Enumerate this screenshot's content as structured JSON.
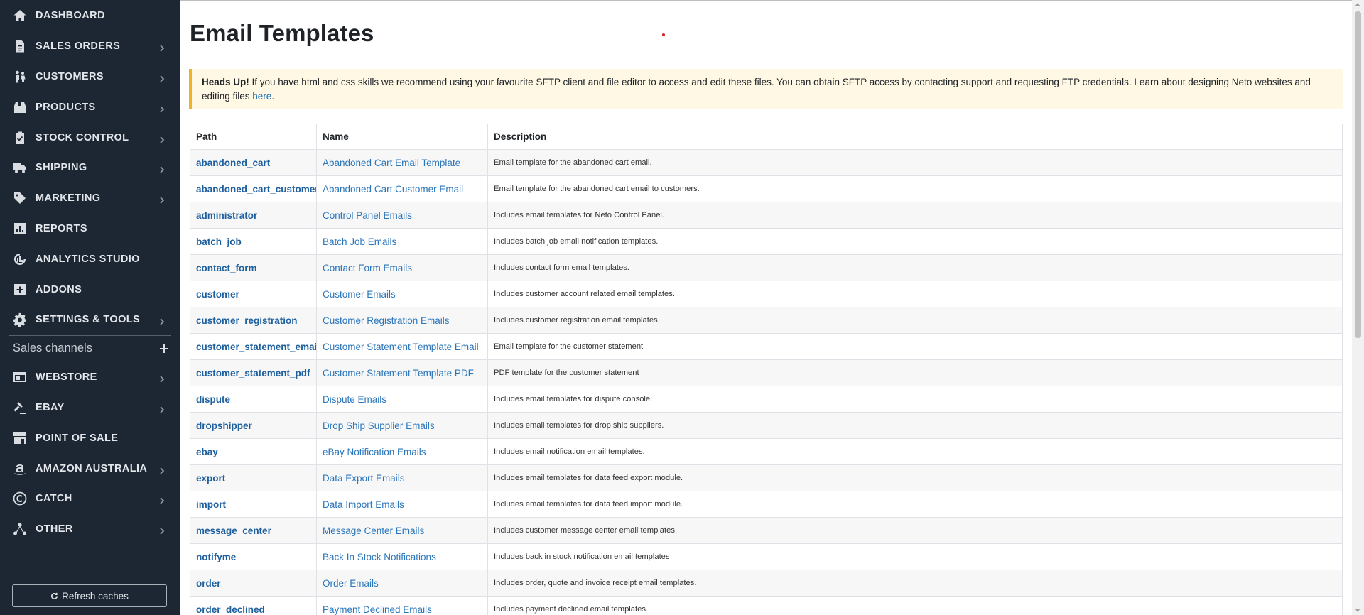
{
  "sidebar": {
    "items": [
      {
        "label": "DASHBOARD",
        "icon": "home-icon",
        "chevron": false
      },
      {
        "label": "SALES ORDERS",
        "icon": "file-icon",
        "chevron": true
      },
      {
        "label": "CUSTOMERS",
        "icon": "users-icon",
        "chevron": true
      },
      {
        "label": "PRODUCTS",
        "icon": "box-icon",
        "chevron": true
      },
      {
        "label": "STOCK CONTROL",
        "icon": "clipboard-check-icon",
        "chevron": true
      },
      {
        "label": "SHIPPING",
        "icon": "truck-icon",
        "chevron": true
      },
      {
        "label": "MARKETING",
        "icon": "tag-icon",
        "chevron": true
      },
      {
        "label": "REPORTS",
        "icon": "bar-chart-icon",
        "chevron": false
      },
      {
        "label": "ANALYTICS STUDIO",
        "icon": "analytics-icon",
        "chevron": false
      },
      {
        "label": "ADDONS",
        "icon": "plus-square-icon",
        "chevron": false
      },
      {
        "label": "SETTINGS & TOOLS",
        "icon": "gear-icon",
        "chevron": true
      }
    ],
    "channels_title": "Sales channels",
    "channels": [
      {
        "label": "WEBSTORE",
        "icon": "browser-icon",
        "chevron": true
      },
      {
        "label": "EBAY",
        "icon": "gavel-icon",
        "chevron": true
      },
      {
        "label": "POINT OF SALE",
        "icon": "store-icon",
        "chevron": false
      },
      {
        "label": "AMAZON AUSTRALIA",
        "icon": "amazon-icon",
        "chevron": true
      },
      {
        "label": "CATCH",
        "icon": "catch-icon",
        "chevron": true
      },
      {
        "label": "OTHER",
        "icon": "network-icon",
        "chevron": true
      }
    ],
    "refresh_label": "Refresh caches"
  },
  "main": {
    "title": "Email Templates",
    "alert": {
      "strong": "Heads Up!",
      "text": " If you have html and css skills we recommend using your favourite SFTP client and file editor to access and edit these files. You can obtain SFTP access by contacting support and requesting FTP credentials. Learn about designing Neto websites and editing files ",
      "link": "here",
      "end": "."
    },
    "table": {
      "headers": [
        "Path",
        "Name",
        "Description"
      ],
      "rows": [
        {
          "path": "abandoned_cart",
          "name": "Abandoned Cart Email Template",
          "desc": "Email template for the abandoned cart email."
        },
        {
          "path": "abandoned_cart_customer",
          "name": "Abandoned Cart Customer Email",
          "desc": "Email template for the abandoned cart email to customers."
        },
        {
          "path": "administrator",
          "name": "Control Panel Emails",
          "desc": "Includes email templates for Neto Control Panel."
        },
        {
          "path": "batch_job",
          "name": "Batch Job Emails",
          "desc": "Includes batch job email notification templates."
        },
        {
          "path": "contact_form",
          "name": "Contact Form Emails",
          "desc": "Includes contact form email templates."
        },
        {
          "path": "customer",
          "name": "Customer Emails",
          "desc": "Includes customer account related email templates."
        },
        {
          "path": "customer_registration",
          "name": "Customer Registration Emails",
          "desc": "Includes customer registration email templates."
        },
        {
          "path": "customer_statement_email",
          "name": "Customer Statement Template Email",
          "desc": "Email template for the customer statement"
        },
        {
          "path": "customer_statement_pdf",
          "name": "Customer Statement Template PDF",
          "desc": "PDF template for the customer statement"
        },
        {
          "path": "dispute",
          "name": "Dispute Emails",
          "desc": "Includes email templates for dispute console."
        },
        {
          "path": "dropshipper",
          "name": "Drop Ship Supplier Emails",
          "desc": "Includes email templates for drop ship suppliers."
        },
        {
          "path": "ebay",
          "name": "eBay Notification Emails",
          "desc": "Includes email notification email templates."
        },
        {
          "path": "export",
          "name": "Data Export Emails",
          "desc": "Includes email templates for data feed export module."
        },
        {
          "path": "import",
          "name": "Data Import Emails",
          "desc": "Includes email templates for data feed import module."
        },
        {
          "path": "message_center",
          "name": "Message Center Emails",
          "desc": "Includes customer message center email templates."
        },
        {
          "path": "notifyme",
          "name": "Back In Stock Notifications",
          "desc": "Includes back in stock notification email templates"
        },
        {
          "path": "order",
          "name": "Order Emails",
          "desc": "Includes order, quote and invoice receipt email templates."
        },
        {
          "path": "order_declined",
          "name": "Payment Declined Emails",
          "desc": "Includes payment declined email templates."
        }
      ]
    }
  }
}
